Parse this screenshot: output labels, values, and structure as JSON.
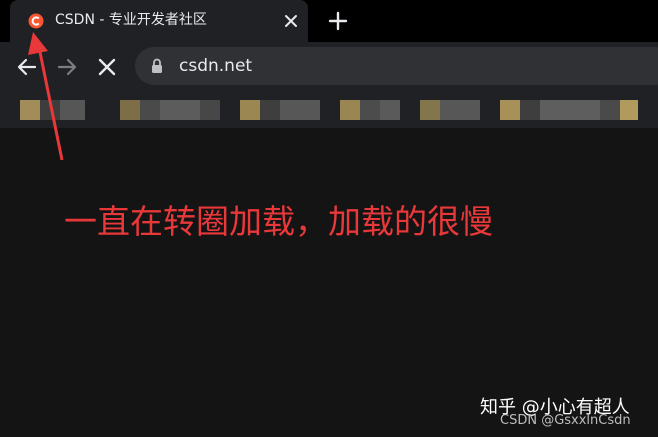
{
  "tab": {
    "title": "CSDN - 专业开发者社区",
    "favicon": "csdn-favicon"
  },
  "toolbar": {
    "url": "csdn.net"
  },
  "icons": {
    "close": "close-icon",
    "new_tab": "plus-icon",
    "back": "back-arrow-icon",
    "forward": "forward-arrow-icon",
    "stop": "stop-loading-icon",
    "lock": "lock-icon"
  },
  "colors": {
    "accent": "#fc5531",
    "annotation": "#e8383a",
    "background": "#141414"
  },
  "annotation": {
    "text": "一直在转圈加载，加载的很慢"
  },
  "watermark": {
    "zhihu": "知乎 @小心有超人",
    "csdn": "CSDN @GsxxlnCsdn"
  }
}
